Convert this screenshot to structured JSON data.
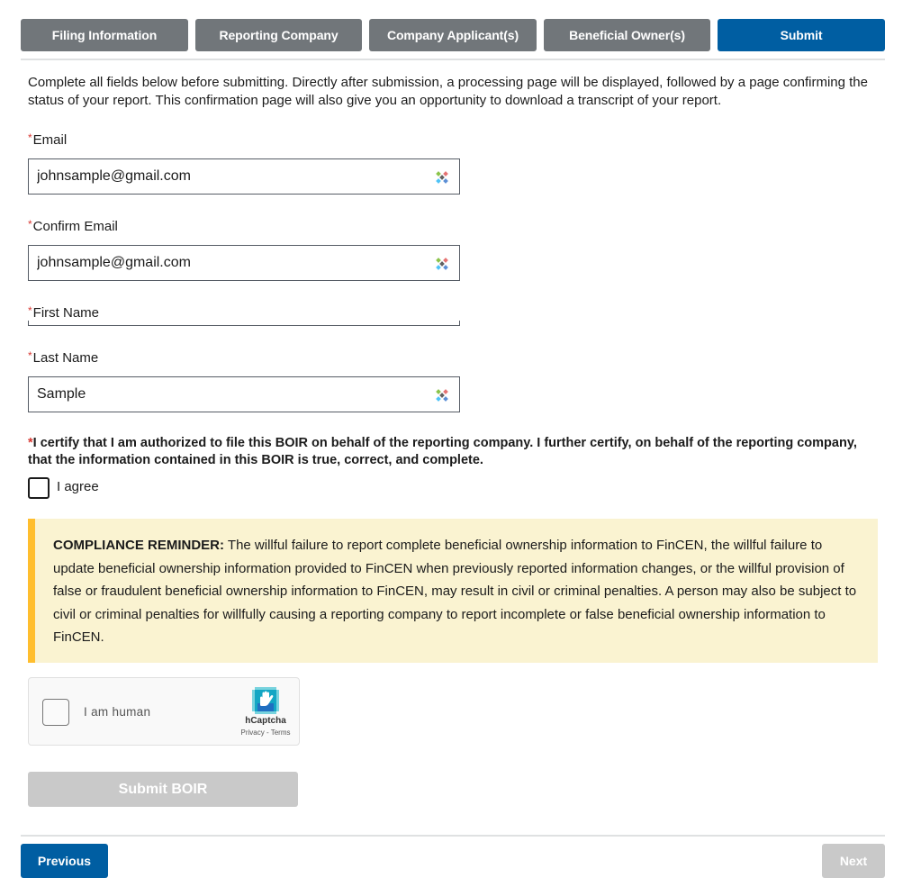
{
  "tabs": [
    {
      "label": "Filing Information",
      "active": false
    },
    {
      "label": "Reporting Company",
      "active": false
    },
    {
      "label": "Company Applicant(s)",
      "active": false
    },
    {
      "label": "Beneficial Owner(s)",
      "active": false
    },
    {
      "label": "Submit",
      "active": true
    }
  ],
  "intro": "Complete all fields below before submitting. Directly after submission, a processing page will be displayed, followed by a page confirming the status of your report. This confirmation page will also give you an opportunity to download a transcript of your report.",
  "required_marker": "*",
  "form": {
    "email": {
      "label": "Email",
      "value": "johnsample@gmail.com"
    },
    "confirm_email": {
      "label": "Confirm Email",
      "value": "johnsample@gmail.com"
    },
    "first_name": {
      "label": "First Name",
      "value": ""
    },
    "last_name": {
      "label": "Last Name",
      "value": "Sample"
    }
  },
  "certification": {
    "text": "I certify that I am authorized to file this BOIR on behalf of the reporting company. I further certify, on behalf of the reporting company, that the information contained in this BOIR is true, correct, and complete.",
    "checkbox_label": "I agree",
    "checked": false
  },
  "reminder": {
    "title": "COMPLIANCE REMINDER:",
    "body": "The willful failure to report complete beneficial ownership information to FinCEN, the willful failure to update beneficial ownership information provided to FinCEN when previously reported information changes, or the willful provision of false or fraudulent beneficial ownership information to FinCEN, may result in civil or criminal penalties. A person may also be subject to civil or criminal penalties for willfully causing a reporting company to report incomplete or false beneficial ownership information to FinCEN."
  },
  "captcha": {
    "label": "I am human",
    "brand": "hCaptcha",
    "links": "Privacy - Terms",
    "checked": false
  },
  "submit_button": {
    "label": "Submit BOIR",
    "disabled": true
  },
  "nav": {
    "previous_label": "Previous",
    "next_label": "Next",
    "next_disabled": true
  },
  "colors": {
    "primary": "#005ea2",
    "tab_inactive": "#71767a",
    "disabled": "#c9c9c9",
    "required": "#d83933",
    "reminder_bg": "#faf3d1",
    "reminder_accent": "#ffbe2e"
  }
}
